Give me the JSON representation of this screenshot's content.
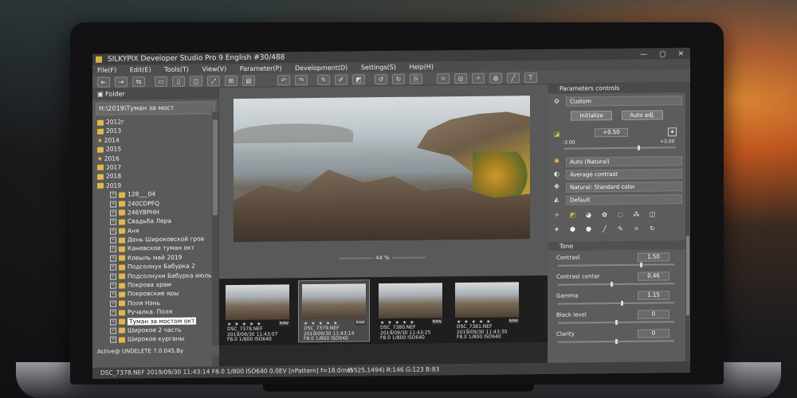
{
  "window": {
    "title": "SILKYPIX Developer Studio Pro 9 English   #30/488"
  },
  "menu": [
    "File(F)",
    "Edit(E)",
    "Tools(T)",
    "View(V)",
    "Parameter(P)",
    "Development(D)",
    "Settings(S)",
    "Help(H)"
  ],
  "sidebar": {
    "header": "Folder",
    "path": "H:\\2019\\Туман за мост",
    "items": [
      {
        "label": "2012г",
        "type": "folder"
      },
      {
        "label": "2013",
        "type": "folder"
      },
      {
        "label": "2014",
        "type": "star"
      },
      {
        "label": "2015",
        "type": "folder"
      },
      {
        "label": "2016",
        "type": "star"
      },
      {
        "label": "2017",
        "type": "folder"
      },
      {
        "label": "2018",
        "type": "folder"
      },
      {
        "label": "2019",
        "type": "folder"
      },
      {
        "label": "128___04",
        "type": "sub"
      },
      {
        "label": "240CDPFQ",
        "type": "sub"
      },
      {
        "label": "246YBPHH",
        "type": "sub"
      },
      {
        "label": "Свадьба Лера",
        "type": "sub"
      },
      {
        "label": "Аня",
        "type": "sub"
      },
      {
        "label": "День Широковской гров",
        "type": "sub"
      },
      {
        "label": "Каневское туман окт",
        "type": "sub"
      },
      {
        "label": "Ковыль май 2019",
        "type": "sub"
      },
      {
        "label": "Подсолнух Бабурка 2",
        "type": "sub"
      },
      {
        "label": "Подсолнухи Бабурка июль",
        "type": "sub"
      },
      {
        "label": "Покрова храм",
        "type": "sub"
      },
      {
        "label": "Покровские яры",
        "type": "sub"
      },
      {
        "label": "Поля Нэнь",
        "type": "sub"
      },
      {
        "label": "Ручалка. Поля",
        "type": "sub"
      },
      {
        "label": "Туман за мостом окт",
        "type": "selected"
      },
      {
        "label": "Широкое 2 часть",
        "type": "sub"
      },
      {
        "label": "Широкое курганы",
        "type": "sub"
      }
    ],
    "footer": "Active@ UNDELETE 7.0.045.By"
  },
  "preview": {
    "zoom": "44 %"
  },
  "filmstrip": [
    {
      "name": "DSC_7378.NEF",
      "date": "2019/09/30 11:43:07",
      "exif": "F8.0 1/800 ISO640",
      "raw": "RAW",
      "stars": "★ ★ ★ ★ ★"
    },
    {
      "name": "DSC_7379.NEF",
      "date": "2019/09/30 11:43:14",
      "exif": "F8.0 1/800 ISO640",
      "raw": "RAW",
      "stars": "★ ★ ★ ★ ★"
    },
    {
      "name": "DSC_7380.NEF",
      "date": "2019/09/30 11:43:25",
      "exif": "F8.0 1/800 ISO640",
      "raw": "RAW",
      "stars": "★ ★ ★ ★ ★"
    },
    {
      "name": "DSC_7381.NEF",
      "date": "2019/09/30 11:43:30",
      "exif": "F8.0 1/800 ISO640",
      "raw": "RAW",
      "stars": "★ ★ ★ ★ ★"
    }
  ],
  "status": {
    "left": "DSC_7378.NEF 2019/09/30 11:43:14 F8.0 1/800 ISO640 0.0EV [nPattern] f=18.0mm",
    "right": "(5525,1494) R:146 G:123 B:83"
  },
  "right_panel": {
    "header": "Parameters controls",
    "taste": "Custom",
    "initialize": "Initialize",
    "auto_adj": "Auto adj.",
    "exposure_value": "+0.50",
    "range_min": "-3.00",
    "range_max": "+3.00",
    "wb": "Auto (Natural)",
    "tone_preset": "Average contrast",
    "color": "Natural: Standard color",
    "sharp": "Default",
    "tone_section": "Tone",
    "sliders": [
      {
        "label": "Contrast",
        "value": "1.50",
        "level": 0.72
      },
      {
        "label": "Contrast center",
        "value": "0.46",
        "level": 0.46
      },
      {
        "label": "Gamma",
        "value": "1.15",
        "level": 0.55
      },
      {
        "label": "Black level",
        "value": "0",
        "level": 0.5
      },
      {
        "label": "Clarity",
        "value": "0",
        "level": 0.5
      }
    ]
  },
  "colors": {
    "accent": "#e2b84a",
    "selected_bg": "#ffffff",
    "panel": "#5c5c5c"
  }
}
